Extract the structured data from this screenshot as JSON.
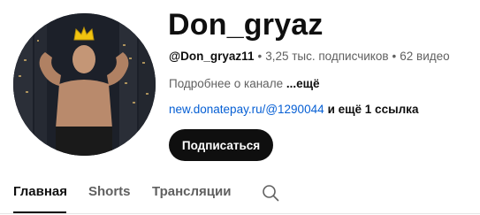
{
  "channel": {
    "name": "Don_gryaz",
    "handle": "@Don_gryaz11",
    "subscribers": "3,25 тыс. подписчиков",
    "videos": "62 видео",
    "separator": "•",
    "about_text": "Подробнее о канале ",
    "about_more": "...ещё",
    "link_text": "new.donatepay.ru/@1290044",
    "link_extra": "и ещё 1 ссылка",
    "subscribe_label": "Подписаться"
  },
  "tabs": [
    {
      "label": "Главная",
      "active": true
    },
    {
      "label": "Shorts",
      "active": false
    },
    {
      "label": "Трансляции",
      "active": false
    }
  ],
  "icons": {
    "search": "search-icon",
    "crown": "crown-icon"
  },
  "colors": {
    "subscribe_bg": "#0f0f0f",
    "link": "#065fd4",
    "secondary_text": "#606060",
    "crown": "#f2c40f"
  }
}
